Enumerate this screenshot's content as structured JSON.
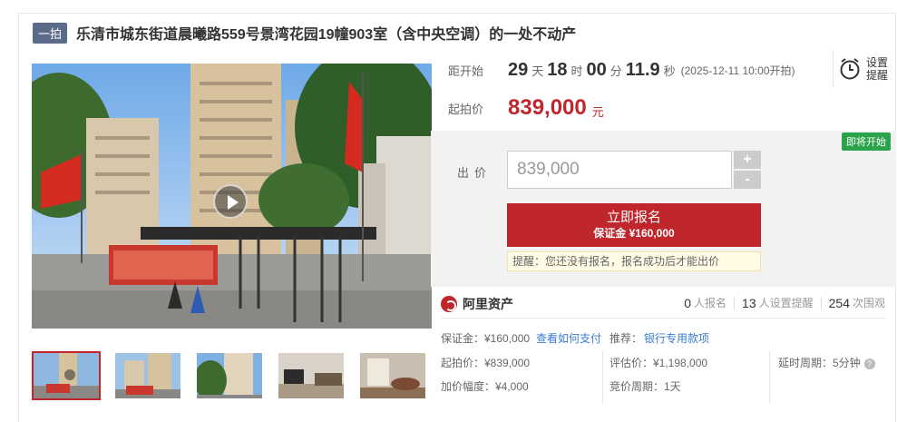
{
  "header": {
    "tag": "一拍",
    "title": "乐清市城东街道晨曦路559号景湾花园19幢903室（含中央空调）的一处不动产"
  },
  "countdown": {
    "label": "距开始",
    "days": "29",
    "days_unit": "天",
    "hours": "18",
    "hours_unit": "时",
    "minutes": "00",
    "minutes_unit": "分",
    "seconds": "11.9",
    "seconds_unit": "秒",
    "start_note": "(2025-12-11 10:00开拍)"
  },
  "remind": {
    "line1": "设置",
    "line2": "提醒",
    "icon": "alarm-clock-icon"
  },
  "start_price": {
    "label": "起拍价",
    "value": "839,000",
    "unit": "元"
  },
  "bid": {
    "badge": "即将开始",
    "label": "出价",
    "input_value": "839,000",
    "plus": "+",
    "minus": "-",
    "signup_label": "立即报名",
    "deposit_label": "保证金 ¥160,000",
    "tip": "提醒：您还没有报名，报名成功后才能出价"
  },
  "platform": {
    "name": "阿里资产",
    "icon": "alibaba-assets-logo-icon"
  },
  "stats": [
    {
      "num": "0",
      "label": "人报名"
    },
    {
      "num": "13",
      "label": "人设置提醒"
    },
    {
      "num": "254",
      "label": "次围观"
    }
  ],
  "details": {
    "deposit": "保证金：¥160,000",
    "how_to_pay": "查看如何支付",
    "recommend_label": "推荐：",
    "recommend_link": "银行专用款项",
    "start_price": "起拍价：¥839,000",
    "appraisal": "评估价：¥1,198,000",
    "delay_period": "延时周期：5分钟",
    "increment": "加价幅度：¥4,000",
    "bid_period": "竞价周期：1天"
  },
  "colors": {
    "accent": "#c0272d",
    "tag_bg": "#5c6b8a",
    "badge_green": "#2aa34a",
    "link": "#3a7bd5"
  }
}
